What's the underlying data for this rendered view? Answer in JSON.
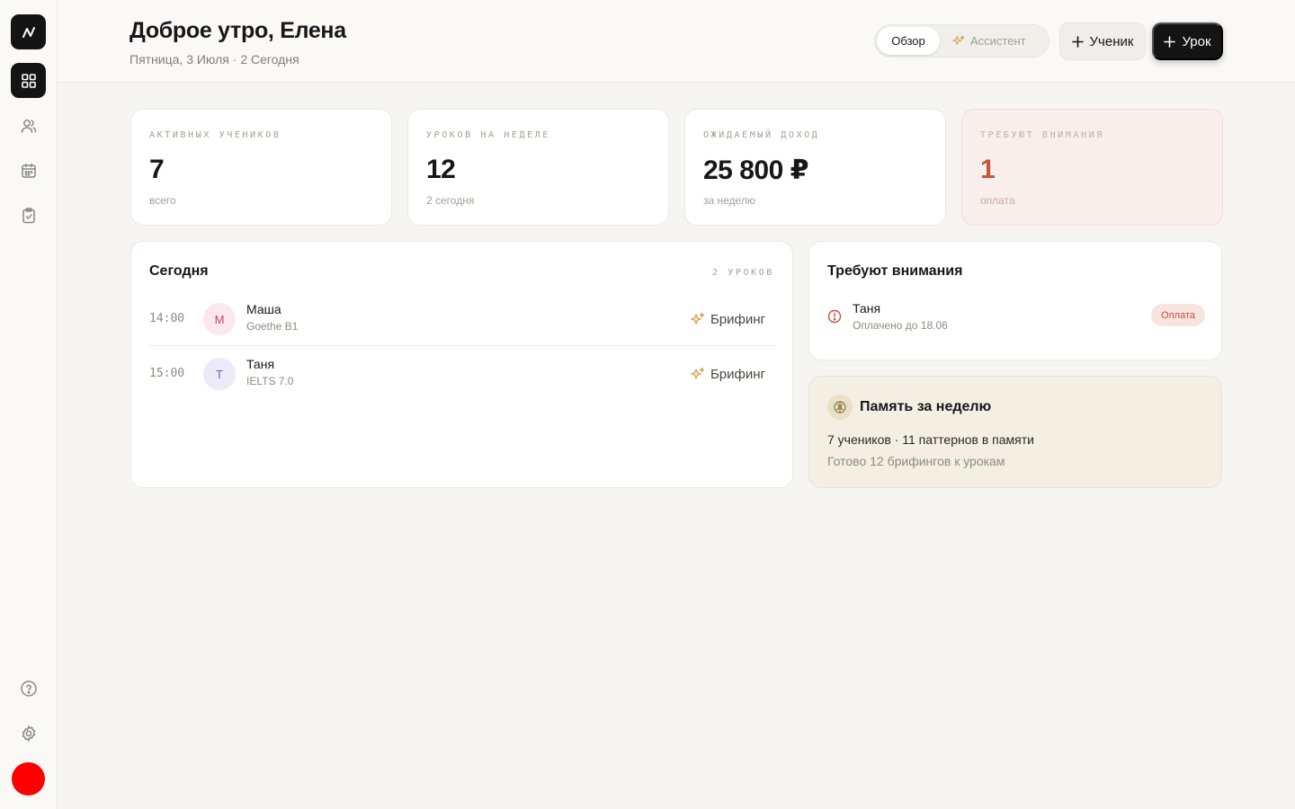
{
  "header": {
    "greeting": "Доброе утро, Елена",
    "date_line": "Пятница, 3 Июля · 2 Сегодня",
    "tabs": [
      {
        "label": "Обзор",
        "active": true
      },
      {
        "label": "Ассистент",
        "active": false
      }
    ],
    "add_student_label": "Ученик",
    "add_lesson_label": "Урок"
  },
  "sidebar": {
    "items": [
      {
        "icon": "dashboard-grid-icon",
        "active": true
      },
      {
        "icon": "users-icon",
        "active": false
      },
      {
        "icon": "calendar-icon",
        "active": false
      },
      {
        "icon": "clipboard-check-icon",
        "active": false
      }
    ],
    "bottom": [
      {
        "icon": "help-circle-icon"
      },
      {
        "icon": "gear-icon"
      }
    ],
    "avatar_color": "#ff0000"
  },
  "stats": [
    {
      "label": "АКТИВНЫХ УЧЕНИКОВ",
      "value": "7",
      "caption": "всего"
    },
    {
      "label": "УРОКОВ НА НЕДЕЛЕ",
      "value": "12",
      "caption": "2 сегодня"
    },
    {
      "label": "ОЖИДАЕМЫЙ ДОХОД",
      "value": "25 800 ₽",
      "caption": "за неделю"
    },
    {
      "label": "ТРЕБУЮТ ВНИМАНИЯ",
      "value": "1",
      "caption": "оплата",
      "warning": true
    }
  ],
  "today": {
    "title": "Сегодня",
    "count": "2 УРОКОВ",
    "lessons": [
      {
        "time": "14:00",
        "initial": "М",
        "name": "Маша",
        "level": "Goethe B1",
        "action": "Брифинг",
        "avatar_bg": "#fbe8ee",
        "avatar_fg": "#c0476e"
      },
      {
        "time": "15:00",
        "initial": "Т",
        "name": "Таня",
        "level": "IELTS 7.0",
        "action": "Брифинг",
        "avatar_bg": "#ece9f8",
        "avatar_fg": "#6e62b0"
      }
    ]
  },
  "attention": {
    "title": "Требуют внимания",
    "items": [
      {
        "name": "Таня",
        "detail": "Оплачено до 18.06",
        "badge": "Оплата"
      }
    ]
  },
  "memory": {
    "title": "Память за неделю",
    "line1": "7 учеников · 11 паттернов в памяти",
    "line2": "Готово 12 брифингов к урокам"
  },
  "colors": {
    "accent_dark": "#141414",
    "warning": "#c4553a",
    "spark": "#d9a24a",
    "background": "#f6f5f1"
  }
}
